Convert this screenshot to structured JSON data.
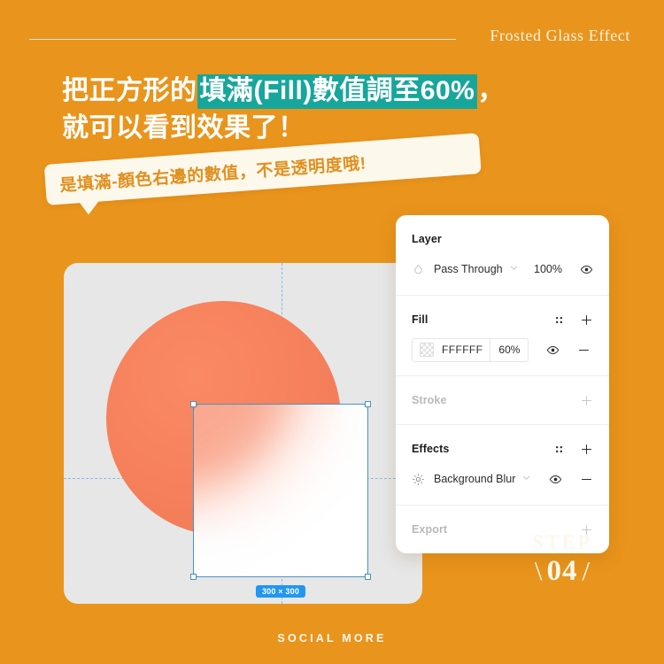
{
  "header": {
    "title": "Frosted Glass Effect"
  },
  "headline": {
    "line1_prefix": "把正方形的",
    "line1_mark": "填滿(Fill)數值調至60%",
    "line1_suffix": "，",
    "line2": "就可以看到效果了！",
    "highlight_color": "#17a69b"
  },
  "bubble": {
    "text": "是填滿-顏色右邊的數值，不是透明度哦!",
    "bg_color": "#fdf8ec",
    "text_color": "#e0901f"
  },
  "canvas": {
    "circle_color": "#f7805c",
    "guide_color": "#7cb8e8",
    "selection_color": "#4a92c4",
    "size_badge": "300 × 300",
    "badge_color": "#2196f3"
  },
  "panel": {
    "layer": {
      "title": "Layer",
      "blend_mode": "Pass Through",
      "opacity": "100%"
    },
    "fill": {
      "title": "Fill",
      "hex": "FFFFFF",
      "opacity": "60%"
    },
    "stroke": {
      "title": "Stroke"
    },
    "effects": {
      "title": "Effects",
      "effect_name": "Background Blur"
    },
    "export": {
      "title": "Export"
    }
  },
  "step": {
    "word": "STEP",
    "number": "04",
    "slash_left": "\\",
    "slash_right": "/"
  },
  "footer": {
    "brand": "SOCIAL MORE"
  },
  "theme": {
    "background": "#e9941c",
    "cream": "#fcf8ee"
  }
}
